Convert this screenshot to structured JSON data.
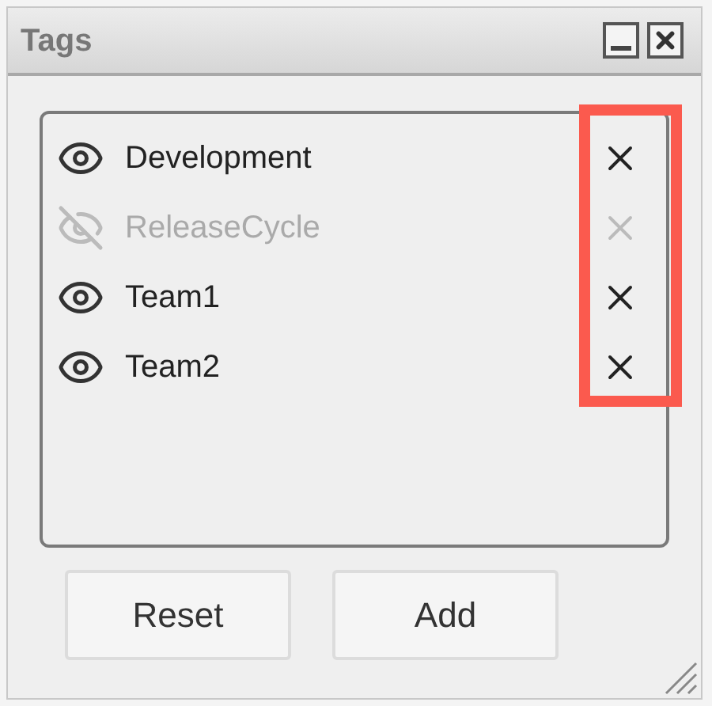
{
  "window": {
    "title": "Tags"
  },
  "tags": [
    {
      "name": "Development",
      "visible": true
    },
    {
      "name": "ReleaseCycle",
      "visible": false
    },
    {
      "name": "Team1",
      "visible": true
    },
    {
      "name": "Team2",
      "visible": true
    }
  ],
  "buttons": [
    "Reset",
    "Add"
  ]
}
